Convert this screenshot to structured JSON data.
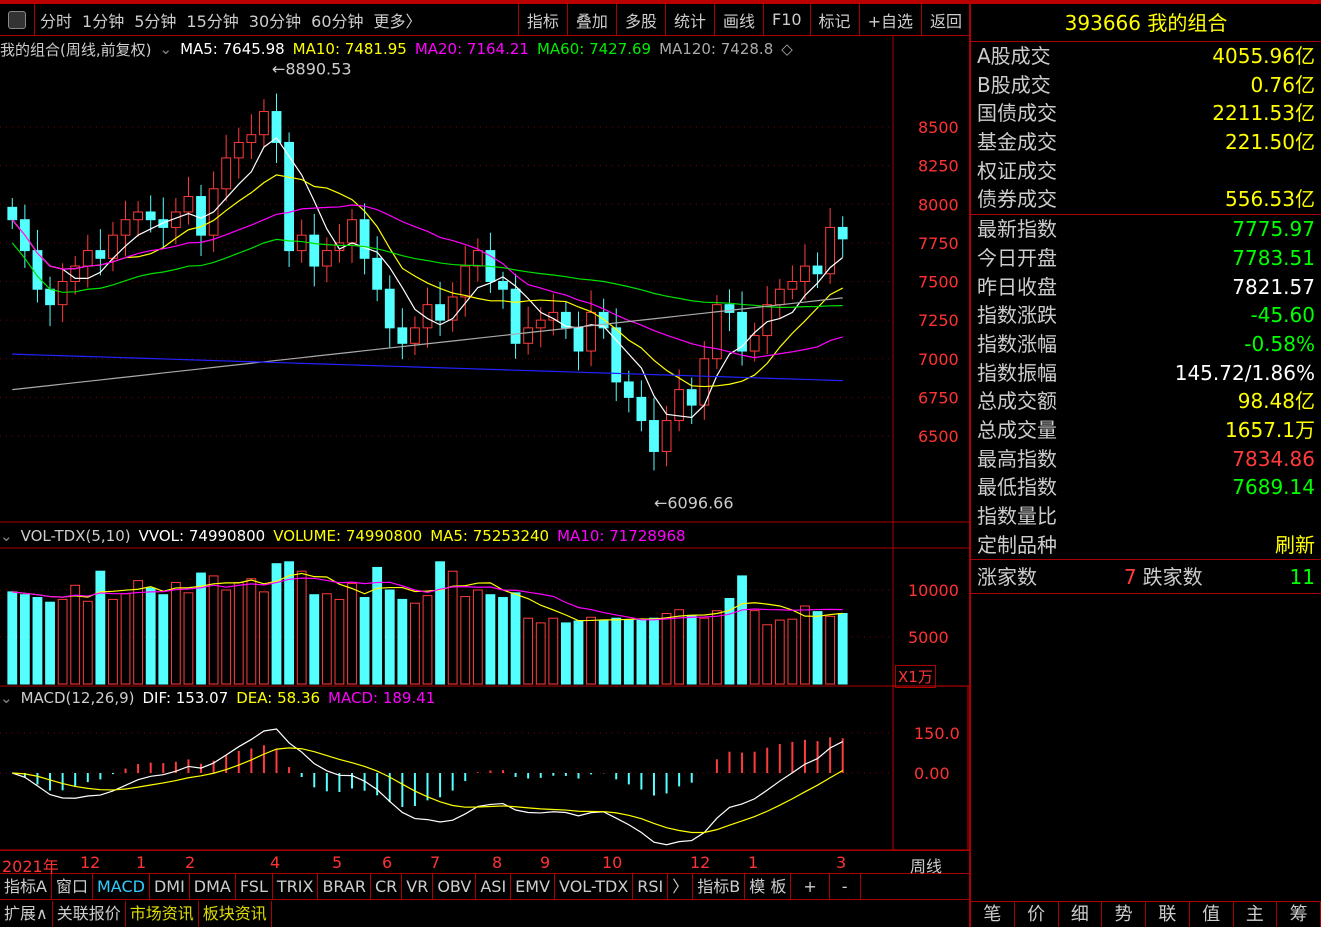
{
  "toolbar": {
    "periods": [
      "分时",
      "1分钟",
      "5分钟",
      "15分钟",
      "30分钟",
      "60分钟",
      "更多〉"
    ],
    "actions": [
      "指标",
      "叠加",
      "多股",
      "统计",
      "画线",
      "F10",
      "标记",
      "+自选",
      "返回"
    ]
  },
  "legend": {
    "title": "我的组合(周线,前复权)",
    "ma5": "MA5: 7645.98",
    "ma10": "MA10: 7481.95",
    "ma20": "MA20: 7164.21",
    "ma60": "MA60: 7427.69",
    "ma120": "MA120: 7428.8"
  },
  "annotations": {
    "high": "8890.53",
    "low": "6096.66"
  },
  "vol_legend": {
    "name": "VOL-TDX(5,10)",
    "vvol": "VVOL: 74990800",
    "volume": "VOLUME: 74990800",
    "ma5": "MA5: 75253240",
    "ma10": "MA10: 71728968",
    "unit": "X1万"
  },
  "macd_legend": {
    "name": "MACD(12,26,9)",
    "dif": "DIF: 153.07",
    "dea": "DEA: 58.36",
    "macd": "MACD: 189.41"
  },
  "colors": {
    "up": "#ff3c3c",
    "down": "#54ffff",
    "ma5": "#ffffff",
    "ma10": "#ffff00",
    "ma20": "#ff00ff",
    "ma60": "#00e000",
    "ma120": "#aaaaaa",
    "border": "#aa0000"
  },
  "chart_data": {
    "type": "candlestick",
    "period": "周线",
    "price_ticks": [
      8500,
      8250,
      8000,
      7750,
      7500,
      7250,
      7000,
      6750,
      6500
    ],
    "vol_ticks": [
      10000,
      5000
    ],
    "macd_ticks": [
      "150.0",
      "0.00"
    ],
    "x_labels": [
      "2021年",
      "12",
      "1",
      "2",
      "4",
      "5",
      "6",
      "7",
      "8",
      "9",
      "10",
      "12",
      "1",
      "3"
    ],
    "close": [
      7900,
      7700,
      7450,
      7350,
      7500,
      7600,
      7700,
      7650,
      7800,
      7900,
      7950,
      7900,
      7850,
      7950,
      8050,
      7800,
      8100,
      8300,
      8400,
      8450,
      8600,
      8400,
      7700,
      7800,
      7600,
      7700,
      7750,
      7900,
      7650,
      7450,
      7200,
      7100,
      7200,
      7350,
      7250,
      7400,
      7600,
      7700,
      7500,
      7450,
      7100,
      7200,
      7250,
      7300,
      7200,
      7050,
      7300,
      7200,
      6850,
      6750,
      6600,
      6400,
      6600,
      6800,
      6700,
      7000,
      7350,
      7300,
      7050,
      7150,
      7350,
      7450,
      7500,
      7600,
      7550,
      7850,
      7776
    ],
    "volume": [
      9800,
      9500,
      9200,
      8700,
      9000,
      10500,
      8800,
      12000,
      9000,
      9600,
      11000,
      10200,
      9500,
      10800,
      9700,
      11800,
      11500,
      10000,
      10800,
      11200,
      9800,
      12800,
      13000,
      12000,
      9500,
      9600,
      9000,
      10700,
      9200,
      12400,
      10000,
      9000,
      8600,
      9400,
      13000,
      12000,
      9300,
      10000,
      9500,
      9200,
      9700,
      7000,
      6500,
      7000,
      6500,
      6700,
      7100,
      6800,
      7000,
      6800,
      6900,
      7000,
      7500,
      7900,
      7300,
      7000,
      7800,
      9100,
      11500,
      7800,
      6300,
      6800,
      6900,
      8300,
      7700,
      7200,
      7500
    ]
  },
  "right": {
    "title": "393666 我的组合",
    "g1": [
      {
        "l": "A股成交",
        "v": "4055.96亿"
      },
      {
        "l": "B股成交",
        "v": "0.76亿"
      },
      {
        "l": "国债成交",
        "v": "2211.53亿"
      },
      {
        "l": "基金成交",
        "v": "221.50亿"
      },
      {
        "l": "权证成交",
        "v": ""
      },
      {
        "l": "债券成交",
        "v": "556.53亿"
      }
    ],
    "g2": [
      {
        "l": "最新指数",
        "v": "7775.97",
        "c": "#00ff00"
      },
      {
        "l": "今日开盘",
        "v": "7783.51",
        "c": "#00ff00"
      },
      {
        "l": "昨日收盘",
        "v": "7821.57",
        "c": "#fff"
      },
      {
        "l": "指数涨跌",
        "v": "-45.60",
        "c": "#00ff00"
      },
      {
        "l": "指数涨幅",
        "v": "-0.58%",
        "c": "#00ff00"
      },
      {
        "l": "指数振幅",
        "v": "145.72/1.86%",
        "c": "#fff"
      },
      {
        "l": "总成交额",
        "v": "98.48亿",
        "c": "#ff0"
      },
      {
        "l": "总成交量",
        "v": "1657.1万",
        "c": "#ff0"
      },
      {
        "l": "最高指数",
        "v": "7834.86",
        "c": "#ff3c3c"
      },
      {
        "l": "最低指数",
        "v": "7689.14",
        "c": "#00ff00"
      },
      {
        "l": "指数量比",
        "v": "",
        "c": "#fff"
      },
      {
        "l": "定制品种",
        "v": "刷新",
        "c": "#ff0"
      }
    ],
    "up_label": "涨家数",
    "up": "7",
    "down_label": "跌家数",
    "down": "11",
    "tabs": [
      "笔",
      "价",
      "细",
      "势",
      "联",
      "值",
      "主",
      "筹"
    ]
  },
  "bottom": {
    "tabs": [
      "指标A",
      "窗口",
      "MACD",
      "DMI",
      "DMA",
      "FSL",
      "TRIX",
      "BRAR",
      "CR",
      "VR",
      "OBV",
      "ASI",
      "EMV",
      "VOL-TDX",
      "RSI",
      "〉",
      "指标B",
      "模 板",
      "+",
      "-"
    ],
    "tabs2": [
      "扩展∧",
      "关联报价",
      "市场资讯",
      "板块资讯"
    ]
  }
}
